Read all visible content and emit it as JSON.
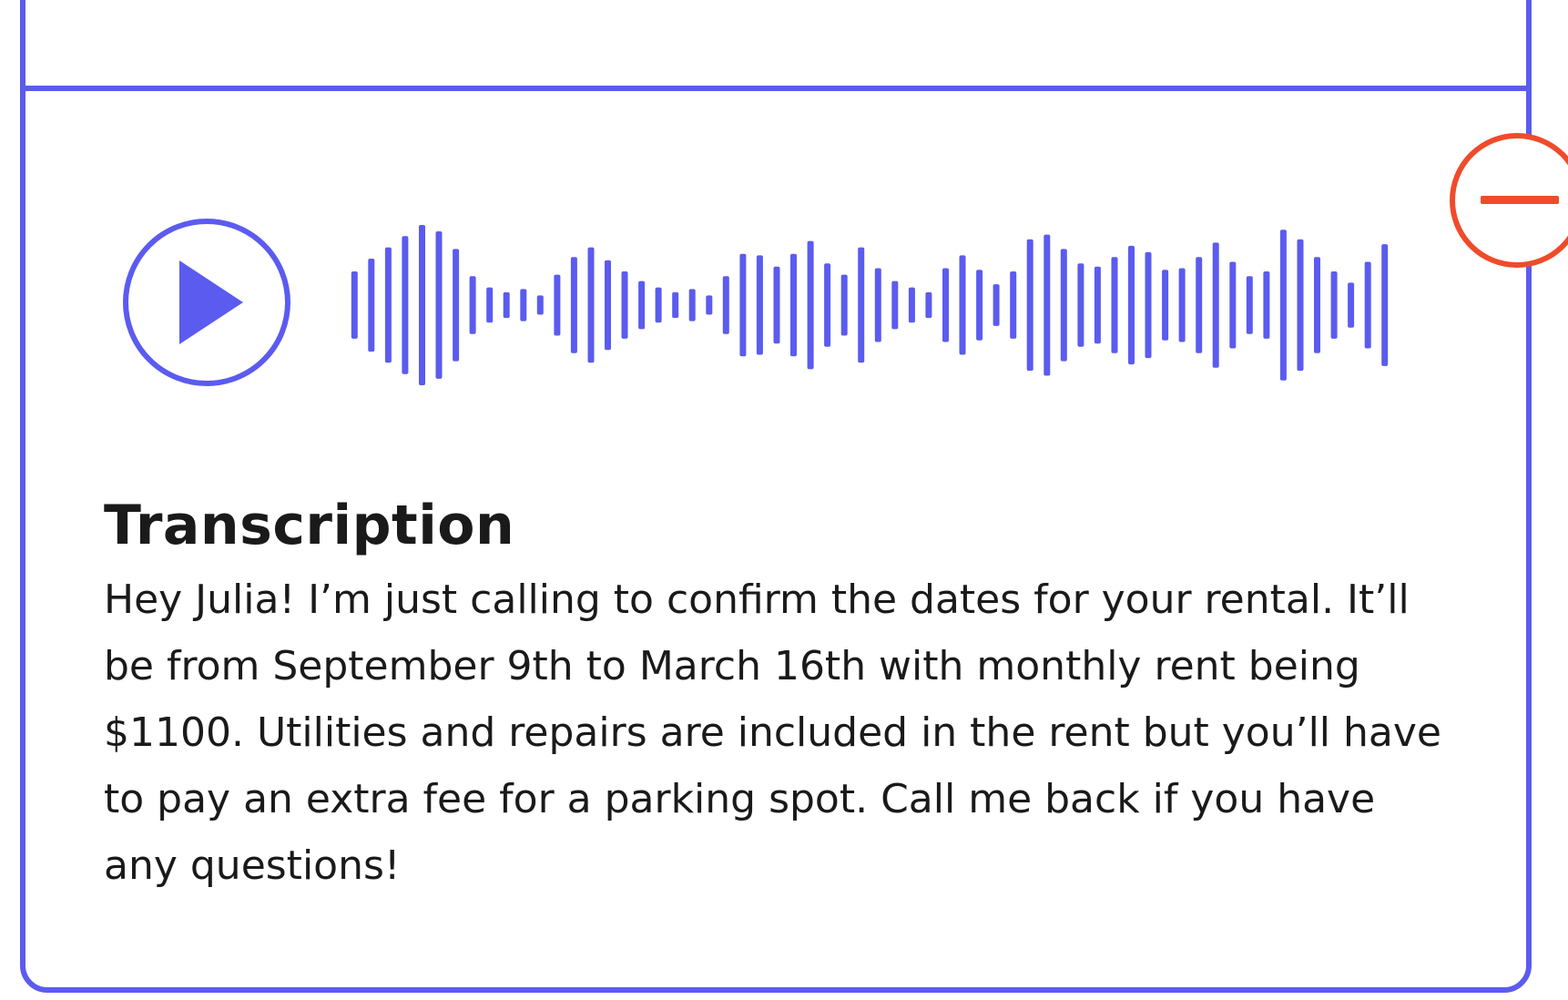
{
  "voice_message": {
    "play_icon": "play-icon",
    "remove_icon": "minus-icon",
    "waveform_heights": [
      0.42,
      0.58,
      0.72,
      0.86,
      1.0,
      0.92,
      0.7,
      0.36,
      0.22,
      0.16,
      0.2,
      0.12,
      0.38,
      0.6,
      0.72,
      0.56,
      0.42,
      0.3,
      0.22,
      0.16,
      0.2,
      0.12,
      0.36,
      0.64,
      0.62,
      0.48,
      0.64,
      0.8,
      0.52,
      0.38,
      0.72,
      0.46,
      0.3,
      0.22,
      0.16,
      0.46,
      0.62,
      0.44,
      0.26,
      0.42,
      0.82,
      0.88,
      0.7,
      0.52,
      0.48,
      0.6,
      0.74,
      0.66,
      0.44,
      0.46,
      0.6,
      0.78,
      0.54,
      0.36,
      0.42,
      0.94,
      0.82,
      0.6,
      0.42,
      0.28,
      0.54,
      0.76
    ],
    "colors": {
      "accent": "#5b5bf0",
      "remove": "#ef4b2b"
    }
  },
  "transcription": {
    "title": "Transcription",
    "text": "Hey Julia! I’m just calling to confirm the dates for your rental. It’ll be from September 9th to March 16th with monthly rent being $1100. Utilities and repairs are included in the rent but you’ll have to pay an extra fee for a parking spot. Call me back if you have any questions!"
  }
}
